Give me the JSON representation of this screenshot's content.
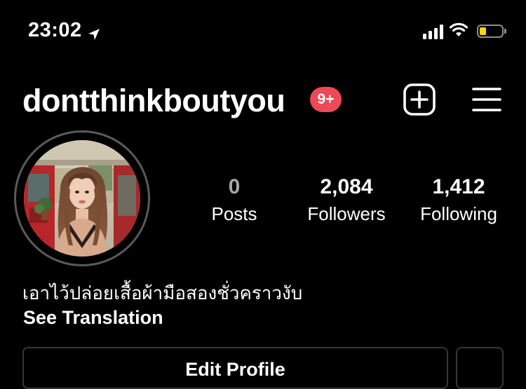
{
  "status_bar": {
    "time": "23:02",
    "location_icon": "location-arrow-icon",
    "battery_color": "#ffd60a",
    "battery_level": 0.3
  },
  "header": {
    "username": "dontthinkboutyou",
    "notification_badge": "9+",
    "badge_color": "#ed4956"
  },
  "stats": {
    "posts": {
      "value": "0",
      "label": "Posts"
    },
    "followers": {
      "value": "2,084",
      "label": "Followers"
    },
    "following": {
      "value": "1,412",
      "label": "Following"
    }
  },
  "bio": {
    "text": "เอาไว้ปล่อยเสื้อผ้ามือสองชั่วคราวงับ",
    "translate_link": "See Translation"
  },
  "actions": {
    "edit_profile_label": "Edit Profile"
  }
}
